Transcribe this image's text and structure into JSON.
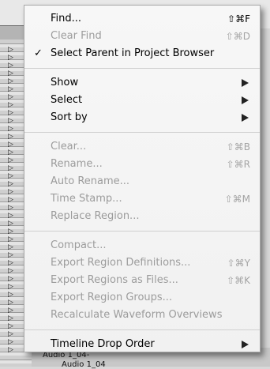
{
  "background": {
    "clip_label_1": "Audio 1_04-",
    "clip_label_2": "Audio 1_04"
  },
  "menu": {
    "groups": [
      [
        {
          "label": "Find...",
          "shortcut": "⇧⌘F",
          "enabled": true,
          "checked": false,
          "submenu": false
        },
        {
          "label": "Clear Find",
          "shortcut": "⇧⌘D",
          "enabled": false,
          "checked": false,
          "submenu": false
        },
        {
          "label": "Select Parent in Project Browser",
          "shortcut": "",
          "enabled": true,
          "checked": true,
          "submenu": false
        }
      ],
      [
        {
          "label": "Show",
          "shortcut": "",
          "enabled": true,
          "checked": false,
          "submenu": true
        },
        {
          "label": "Select",
          "shortcut": "",
          "enabled": true,
          "checked": false,
          "submenu": true
        },
        {
          "label": "Sort by",
          "shortcut": "",
          "enabled": true,
          "checked": false,
          "submenu": true
        }
      ],
      [
        {
          "label": "Clear...",
          "shortcut": "⇧⌘B",
          "enabled": false,
          "checked": false,
          "submenu": false
        },
        {
          "label": "Rename...",
          "shortcut": "⇧⌘R",
          "enabled": false,
          "checked": false,
          "submenu": false
        },
        {
          "label": "Auto Rename...",
          "shortcut": "",
          "enabled": false,
          "checked": false,
          "submenu": false
        },
        {
          "label": "Time Stamp...",
          "shortcut": "⇧⌘M",
          "enabled": false,
          "checked": false,
          "submenu": false
        },
        {
          "label": "Replace Region...",
          "shortcut": "",
          "enabled": false,
          "checked": false,
          "submenu": false
        }
      ],
      [
        {
          "label": "Compact...",
          "shortcut": "",
          "enabled": false,
          "checked": false,
          "submenu": false
        },
        {
          "label": "Export Region Definitions...",
          "shortcut": "⇧⌘Y",
          "enabled": false,
          "checked": false,
          "submenu": false
        },
        {
          "label": "Export Regions as Files...",
          "shortcut": "⇧⌘K",
          "enabled": false,
          "checked": false,
          "submenu": false
        },
        {
          "label": "Export Region Groups...",
          "shortcut": "",
          "enabled": false,
          "checked": false,
          "submenu": false
        },
        {
          "label": "Recalculate Waveform Overviews",
          "shortcut": "",
          "enabled": false,
          "checked": false,
          "submenu": false
        }
      ],
      [
        {
          "label": "Timeline Drop Order",
          "shortcut": "",
          "enabled": true,
          "checked": false,
          "submenu": true
        }
      ]
    ]
  }
}
